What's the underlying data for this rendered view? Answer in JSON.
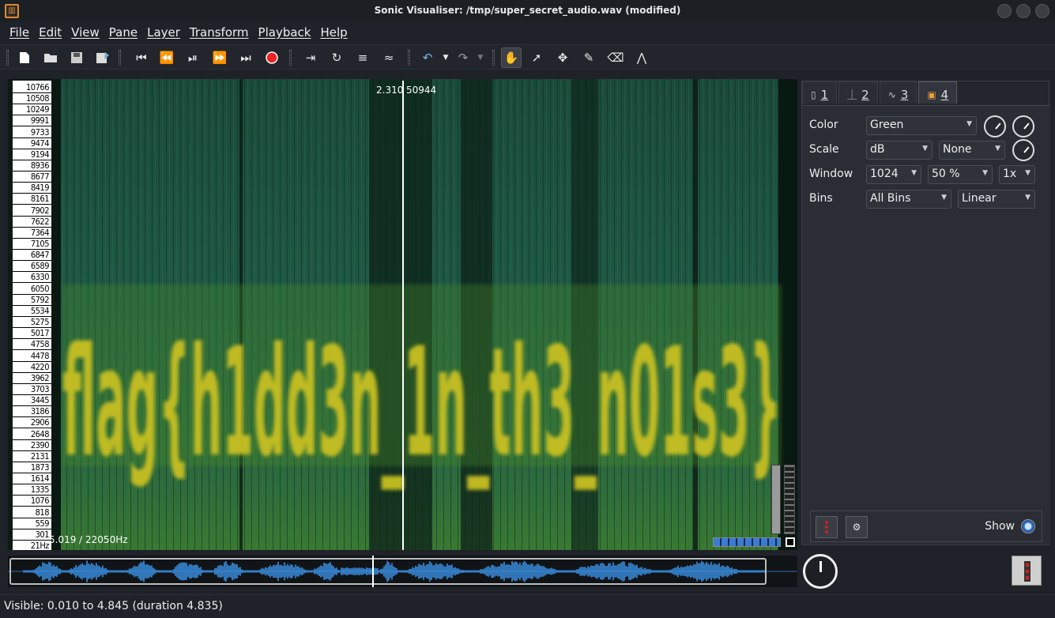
{
  "window": {
    "title": "Sonic Visualiser: /tmp/super_secret_audio.wav (modified)",
    "icon_name": "sonic-visualiser-icon"
  },
  "menu": [
    "File",
    "Edit",
    "View",
    "Pane",
    "Layer",
    "Transform",
    "Playback",
    "Help"
  ],
  "pane": {
    "cursor_time": "2.310",
    "cursor_value": "50944",
    "status": "5.019 / 22050Hz",
    "hidden_text": "flag{h1dd3n_1n_th3_n01s3}",
    "freq_labels": [
      "10766",
      "10508",
      "10249",
      "9991",
      "9733",
      "9474",
      "9194",
      "8936",
      "8677",
      "8419",
      "8161",
      "7902",
      "7622",
      "7364",
      "7105",
      "6847",
      "6589",
      "6330",
      "6050",
      "5792",
      "5534",
      "5275",
      "5017",
      "4758",
      "4478",
      "4220",
      "3962",
      "3703",
      "3445",
      "3186",
      "2906",
      "2648",
      "2390",
      "2131",
      "1873",
      "1614",
      "1335",
      "1076",
      "818",
      "559",
      "301",
      "21Hz"
    ]
  },
  "panel": {
    "tabs": [
      {
        "label": "1",
        "icon": "pane-icon"
      },
      {
        "label": "2",
        "icon": "ruler-icon"
      },
      {
        "label": "3",
        "icon": "waveform-icon"
      },
      {
        "label": "4",
        "icon": "spectrogram-icon"
      }
    ],
    "color_label": "Color",
    "color_value": "Green",
    "scale_label": "Scale",
    "scale_value": "dB",
    "normalize_value": "None",
    "window_label": "Window",
    "window_size": "1024",
    "window_overlap": "50 %",
    "oversample": "1x",
    "bins_label": "Bins",
    "bins_value": "All Bins",
    "bins_scale": "Linear",
    "show_label": "Show"
  },
  "status": {
    "text": "Visible: 0.010 to 4.845 (duration 4.835)"
  },
  "colors": {
    "spectro_bg": "#0e2a22",
    "spectro_mid": "#1e5a44",
    "text_yellow": "#c8c020",
    "wave_blue": "#3a8ee0"
  }
}
